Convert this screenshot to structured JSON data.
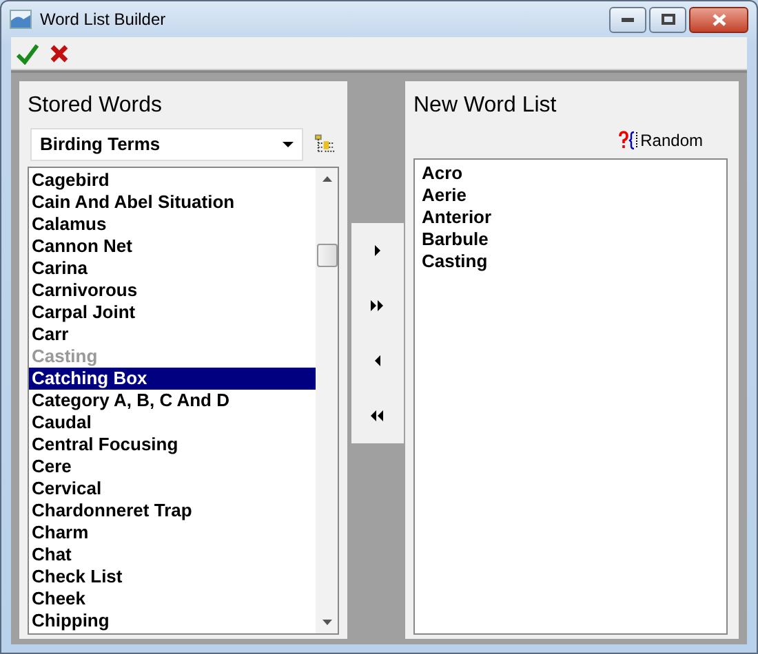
{
  "window": {
    "title": "Word List Builder"
  },
  "stored_words": {
    "title": "Stored Words",
    "category": "Birding Terms",
    "items": [
      {
        "text": "Cagebird",
        "selected": false,
        "disabled": false
      },
      {
        "text": "Cain And Abel Situation",
        "selected": false,
        "disabled": false
      },
      {
        "text": "Calamus",
        "selected": false,
        "disabled": false
      },
      {
        "text": "Cannon Net",
        "selected": false,
        "disabled": false
      },
      {
        "text": "Carina",
        "selected": false,
        "disabled": false
      },
      {
        "text": "Carnivorous",
        "selected": false,
        "disabled": false
      },
      {
        "text": "Carpal Joint",
        "selected": false,
        "disabled": false
      },
      {
        "text": "Carr",
        "selected": false,
        "disabled": false
      },
      {
        "text": "Casting",
        "selected": false,
        "disabled": true
      },
      {
        "text": "Catching Box",
        "selected": true,
        "disabled": false
      },
      {
        "text": "Category A, B, C And D",
        "selected": false,
        "disabled": false
      },
      {
        "text": "Caudal",
        "selected": false,
        "disabled": false
      },
      {
        "text": "Central Focusing",
        "selected": false,
        "disabled": false
      },
      {
        "text": "Cere",
        "selected": false,
        "disabled": false
      },
      {
        "text": "Cervical",
        "selected": false,
        "disabled": false
      },
      {
        "text": "Chardonneret Trap",
        "selected": false,
        "disabled": false
      },
      {
        "text": "Charm",
        "selected": false,
        "disabled": false
      },
      {
        "text": "Chat",
        "selected": false,
        "disabled": false
      },
      {
        "text": "Check List",
        "selected": false,
        "disabled": false
      },
      {
        "text": "Cheek",
        "selected": false,
        "disabled": false
      },
      {
        "text": "Chipping",
        "selected": false,
        "disabled": false
      }
    ]
  },
  "transfer_buttons": [
    {
      "kind": "add"
    },
    {
      "kind": "add_all"
    },
    {
      "kind": "remove"
    },
    {
      "kind": "remove_all"
    }
  ],
  "new_word_list": {
    "title": "New Word List",
    "random_button": "Random",
    "items": [
      "Acro",
      "Aerie",
      "Anterior",
      "Barbule",
      "Casting"
    ]
  }
}
